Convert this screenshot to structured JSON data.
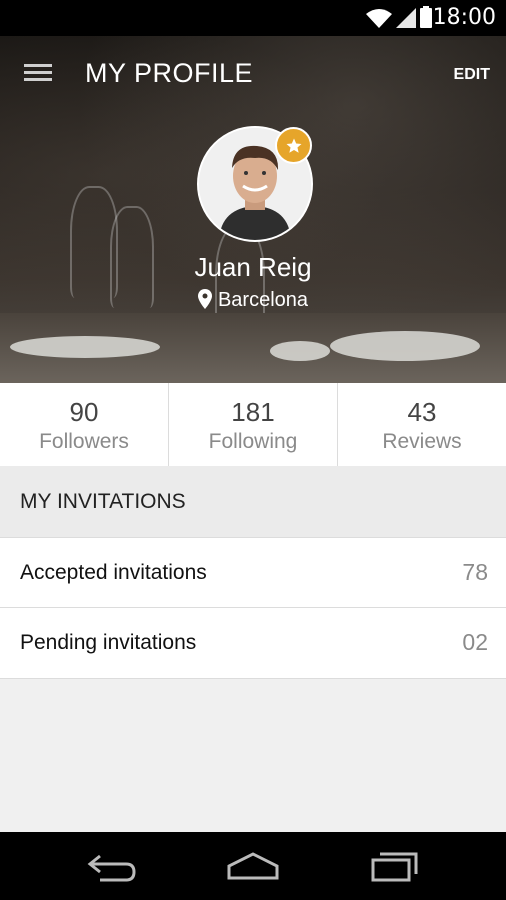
{
  "status_bar": {
    "time": "18:00",
    "icons": [
      "wifi-icon",
      "signal-icon",
      "battery-icon"
    ]
  },
  "header": {
    "title": "MY PROFILE",
    "edit_label": "EDIT"
  },
  "profile": {
    "name": "Juan Reig",
    "location": "Barcelona",
    "badge_icon": "star-icon"
  },
  "stats": [
    {
      "value": "90",
      "label": "Followers"
    },
    {
      "value": "181",
      "label": "Following"
    },
    {
      "value": "43",
      "label": "Reviews"
    }
  ],
  "invitations": {
    "title": "MY INVITATIONS",
    "items": [
      {
        "label": "Accepted invitations",
        "count": "78"
      },
      {
        "label": "Pending invitations",
        "count": "02"
      }
    ]
  },
  "colors": {
    "accent": "#e6a52a",
    "statusbar": "#000000",
    "text_muted": "#8a8a8a"
  },
  "nav_bar": {
    "buttons": [
      "back-icon",
      "home-icon",
      "recents-icon"
    ]
  }
}
